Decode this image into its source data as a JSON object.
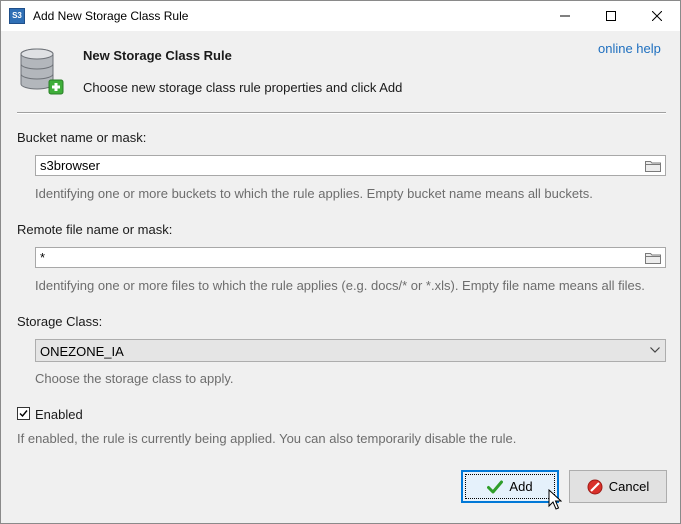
{
  "window": {
    "title": "Add New Storage Class Rule",
    "app_icon_text": "S3"
  },
  "header": {
    "title": "New Storage Class Rule",
    "subtitle": "Choose new storage class rule properties and click Add",
    "online_help": "online help"
  },
  "bucket": {
    "label": "Bucket name or mask:",
    "value": "s3browser",
    "hint": "Identifying one or more buckets to which the rule applies. Empty bucket name means all buckets."
  },
  "remote_file": {
    "label": "Remote file name or mask:",
    "value": "*",
    "hint": "Identifying one or more files to which the rule applies (e.g. docs/* or *.xls). Empty file name means all files."
  },
  "storage_class": {
    "label": "Storage Class:",
    "selected": "ONEZONE_IA",
    "hint": "Choose the storage class to apply."
  },
  "enabled": {
    "label": "Enabled",
    "checked": true,
    "hint": "If enabled, the rule is currently being applied. You can also temporarily disable the rule."
  },
  "buttons": {
    "add": "Add",
    "cancel": "Cancel"
  },
  "colors": {
    "accent": "#0078d7",
    "link": "#1e6fbf",
    "hint_text": "#6d6d6d"
  }
}
